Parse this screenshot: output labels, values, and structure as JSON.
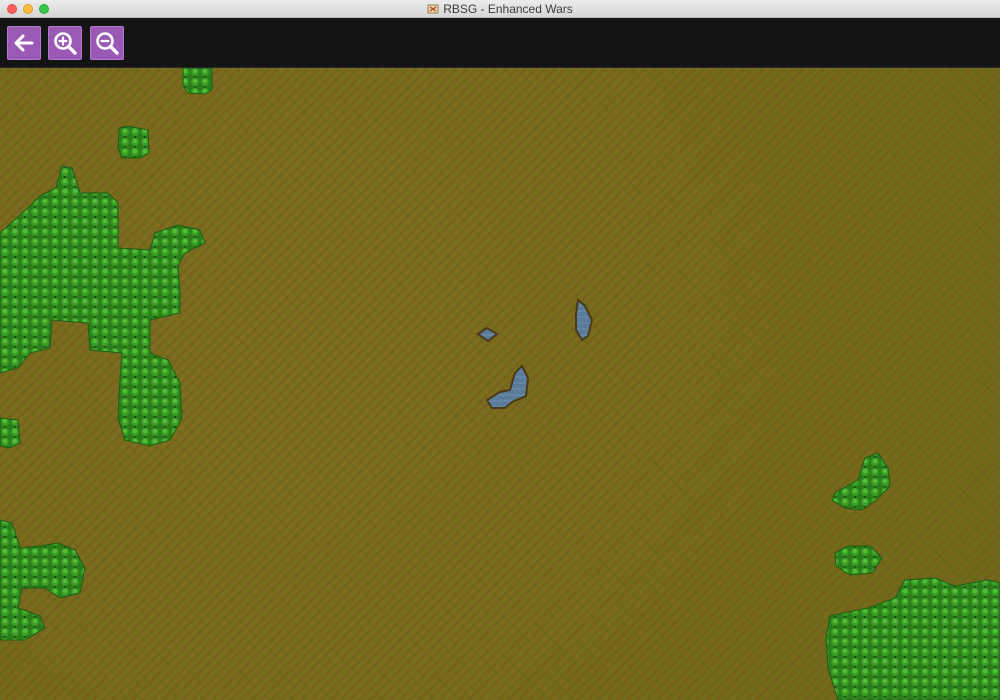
{
  "window": {
    "title": "RBSG - Enhanced Wars"
  },
  "toolbar": {
    "buttons": [
      {
        "name": "back-button",
        "icon": "arrow-left-icon"
      },
      {
        "name": "zoom-in-button",
        "icon": "zoom-in-icon"
      },
      {
        "name": "zoom-out-button",
        "icon": "zoom-out-icon"
      }
    ]
  },
  "colors": {
    "button_bg": "#9b59b6",
    "toolbar_bg": "#141414",
    "grass": "#7a6a1c",
    "forest": "#2f8a1e",
    "water": "#5c7d9a"
  },
  "map": {
    "terrain_types": [
      "grass",
      "forest",
      "water"
    ]
  }
}
